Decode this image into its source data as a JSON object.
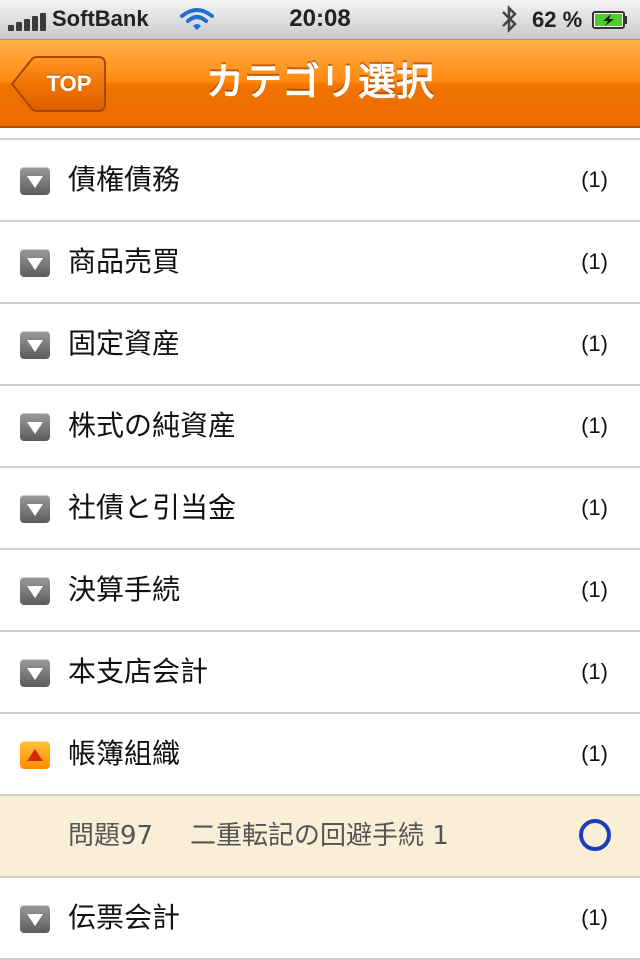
{
  "status_bar": {
    "carrier": "SoftBank",
    "time": "20:08",
    "battery_percent": "62 %",
    "signal_icon": "signal-bars-icon",
    "wifi_icon": "wifi-icon",
    "bluetooth_icon": "bluetooth-icon",
    "battery_icon": "battery-charging-icon"
  },
  "nav": {
    "back_label": "TOP",
    "title": "カテゴリ選択"
  },
  "colors": {
    "nav_orange": "#f07400",
    "highlight_row": "#f8efd6",
    "correct_mark": "#1e3cbe"
  },
  "categories": [
    {
      "label": "債権債務",
      "count": "(1)",
      "expanded": false
    },
    {
      "label": "商品売買",
      "count": "(1)",
      "expanded": false
    },
    {
      "label": "固定資産",
      "count": "(1)",
      "expanded": false
    },
    {
      "label": "株式の純資産",
      "count": "(1)",
      "expanded": false
    },
    {
      "label": "社債と引当金",
      "count": "(1)",
      "expanded": false
    },
    {
      "label": "決算手続",
      "count": "(1)",
      "expanded": false
    },
    {
      "label": "本支店会計",
      "count": "(1)",
      "expanded": false
    },
    {
      "label": "帳簿組織",
      "count": "(1)",
      "expanded": true
    },
    {
      "label": "伝票会計",
      "count": "(1)",
      "expanded": false
    }
  ],
  "expanded_question": {
    "number": "問題97",
    "title": "二重転記の回避手続 1",
    "result_icon": "circle-correct-icon"
  }
}
